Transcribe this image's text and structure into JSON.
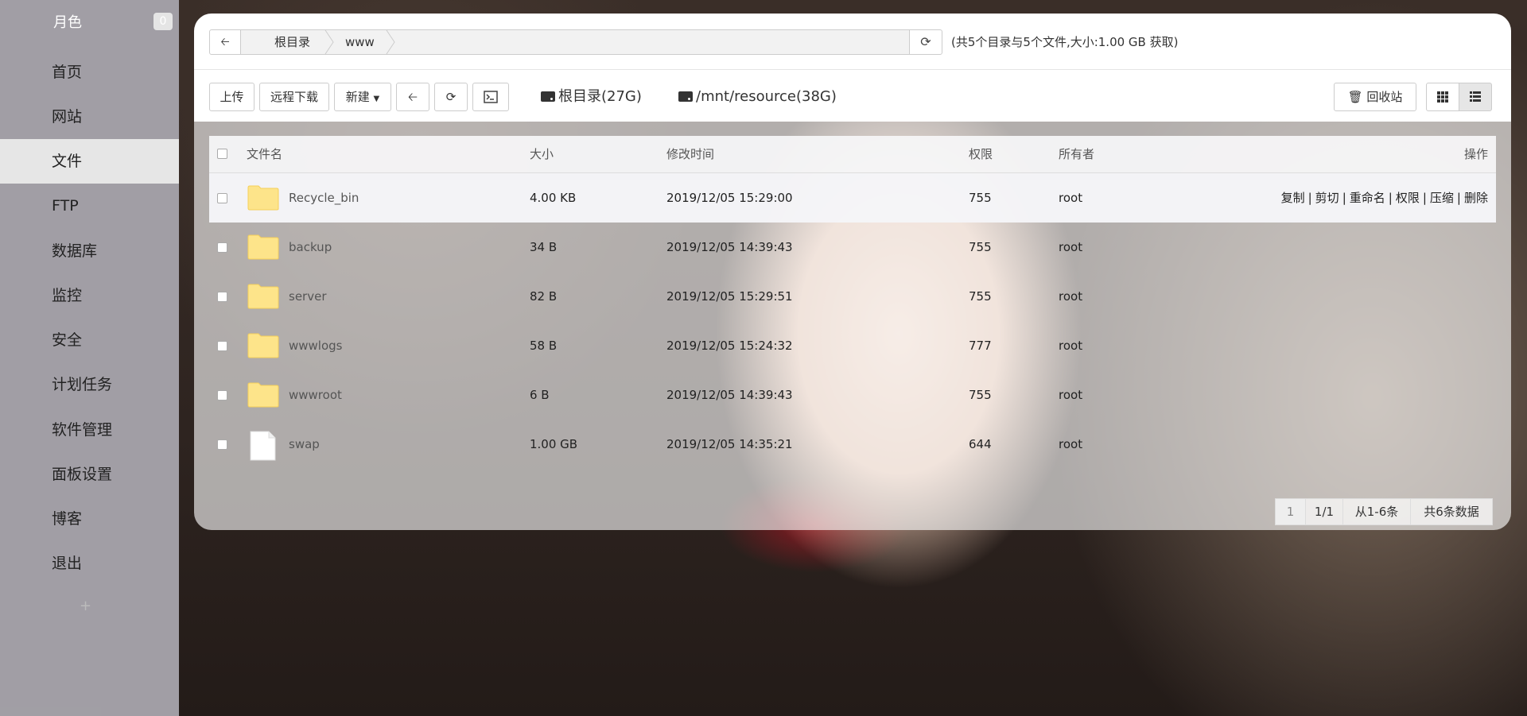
{
  "sidebar": {
    "brand": "月色",
    "badge": "0",
    "items": [
      {
        "label": "首页"
      },
      {
        "label": "网站"
      },
      {
        "label": "文件"
      },
      {
        "label": "FTP"
      },
      {
        "label": "数据库"
      },
      {
        "label": "监控"
      },
      {
        "label": "安全"
      },
      {
        "label": "计划任务"
      },
      {
        "label": "软件管理"
      },
      {
        "label": "面板设置"
      },
      {
        "label": "博客"
      },
      {
        "label": "退出"
      }
    ],
    "active_index": 2
  },
  "pathbar": {
    "crumbs": [
      "根目录",
      "www"
    ],
    "summary": "(共5个目录与5个文件,大小:1.00 GB 获取)"
  },
  "toolbar": {
    "upload": "上传",
    "remote_download": "远程下载",
    "new": "新建",
    "disks": [
      "根目录(27G)",
      "/mnt/resource(38G)"
    ],
    "recycle": "回收站"
  },
  "table": {
    "headers": {
      "name": "文件名",
      "size": "大小",
      "mtime": "修改时间",
      "perm": "权限",
      "owner": "所有者",
      "ops": "操作"
    },
    "rows": [
      {
        "name": "Recycle_bin",
        "type": "folder",
        "size": "4.00 KB",
        "mtime": "2019/12/05 15:29:00",
        "perm": "755",
        "owner": "root"
      },
      {
        "name": "backup",
        "type": "folder",
        "size": "34 B",
        "mtime": "2019/12/05 14:39:43",
        "perm": "755",
        "owner": "root"
      },
      {
        "name": "server",
        "type": "folder",
        "size": "82 B",
        "mtime": "2019/12/05 15:29:51",
        "perm": "755",
        "owner": "root"
      },
      {
        "name": "wwwlogs",
        "type": "folder",
        "size": "58 B",
        "mtime": "2019/12/05 15:24:32",
        "perm": "777",
        "owner": "root"
      },
      {
        "name": "wwwroot",
        "type": "folder",
        "size": "6 B",
        "mtime": "2019/12/05 14:39:43",
        "perm": "755",
        "owner": "root"
      },
      {
        "name": "swap",
        "type": "file",
        "size": "1.00 GB",
        "mtime": "2019/12/05 14:35:21",
        "perm": "644",
        "owner": "root"
      }
    ],
    "row_ops": [
      "复制",
      "剪切",
      "重命名",
      "权限",
      "压缩",
      "删除"
    ]
  },
  "pager": {
    "current": "1",
    "pages": "1/1",
    "range": "从1-6条",
    "total": "共6条数据"
  },
  "colors": {
    "folder": "#fde48a",
    "folder_edge": "#f5cf5a",
    "sidebar_active": "#e6e6e6"
  }
}
